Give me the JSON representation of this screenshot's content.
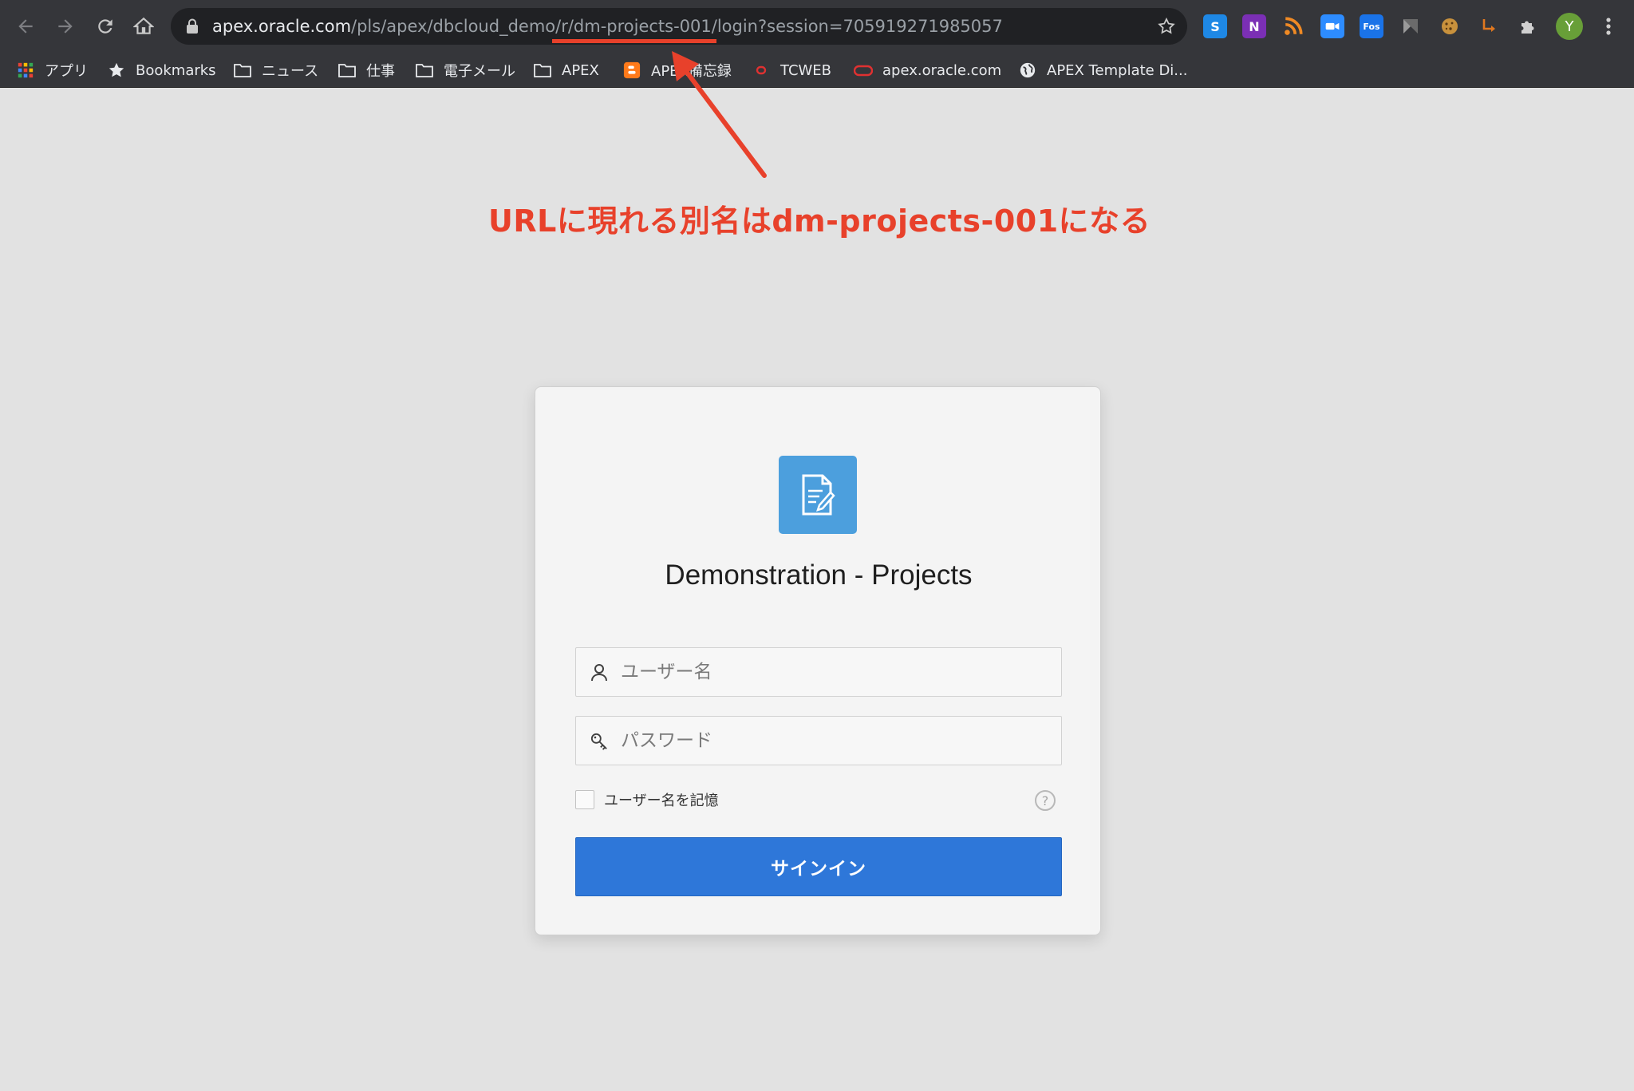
{
  "browser": {
    "url_host": "apex.oracle.com",
    "url_path": "/pls/apex/dbcloud_demo/r/dm-projects-001/login?session=705919271985057",
    "extensions": [
      {
        "name": "s-extension-icon",
        "glyph": "S",
        "color": "#1e88e5"
      },
      {
        "name": "onenote-icon",
        "glyph": "N",
        "color": "#7b2fb5"
      },
      {
        "name": "rss-icon",
        "glyph": "",
        "color": "#f08a24"
      },
      {
        "name": "zoom-icon",
        "glyph": "",
        "color": "#2d8cff"
      },
      {
        "name": "fos-icon",
        "glyph": "Fos",
        "color": "#1a73e8"
      },
      {
        "name": "flag-icon",
        "glyph": "",
        "color": "#6b6b6b"
      },
      {
        "name": "cookie-icon",
        "glyph": "",
        "color": "#c8913c"
      },
      {
        "name": "arrow-extension-icon",
        "glyph": "",
        "color": "#e0781f"
      },
      {
        "name": "puzzle-icon",
        "glyph": "",
        "color": "#d0d0d0"
      }
    ],
    "avatar_initial": "Y"
  },
  "bookmarks": [
    {
      "label": "アプリ",
      "icon": "apps-grid-icon"
    },
    {
      "label": "Bookmarks",
      "icon": "star-icon"
    },
    {
      "label": "ニュース",
      "icon": "folder-icon"
    },
    {
      "label": "仕事",
      "icon": "folder-icon"
    },
    {
      "label": "電子メール",
      "icon": "folder-icon"
    },
    {
      "label": "APEX",
      "icon": "folder-icon"
    },
    {
      "label": "APEX備忘録",
      "icon": "blogger-icon"
    },
    {
      "label": "TCWEB",
      "icon": "oracle-small-icon"
    },
    {
      "label": "apex.oracle.com",
      "icon": "oracle-icon"
    },
    {
      "label": "APEX Template Di...",
      "icon": "globe-icon"
    }
  ],
  "annotation": {
    "text": "URLに現れる別名はdm-projects-001になる",
    "color": "#e8412b"
  },
  "login": {
    "app_title": "Demonstration - Projects",
    "username_placeholder": "ユーザー名",
    "password_placeholder": "パスワード",
    "remember_label": "ユーザー名を記憶",
    "remember_checked": false,
    "help_glyph": "?",
    "signin_label": "サインイン",
    "accent_color": "#2e77d9"
  }
}
